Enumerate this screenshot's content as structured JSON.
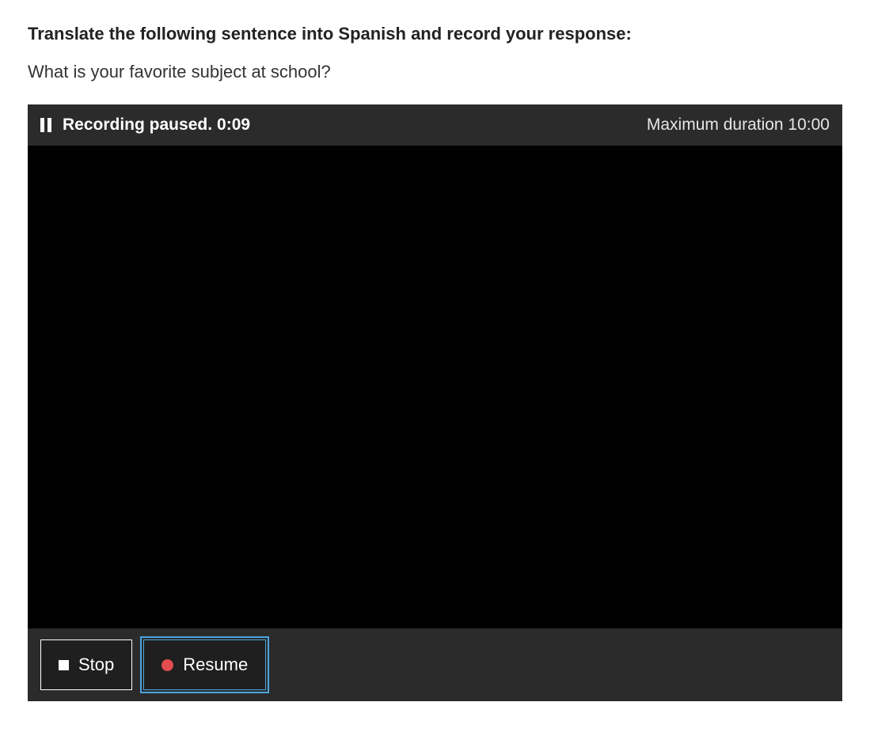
{
  "prompt": {
    "title": "Translate the following sentence into Spanish and record your response:",
    "text": "What is your favorite subject at school?"
  },
  "recorder": {
    "status_label": "Recording paused.",
    "elapsed": "0:09",
    "max_duration_label": "Maximum duration 10:00",
    "stop_label": "Stop",
    "resume_label": "Resume"
  }
}
